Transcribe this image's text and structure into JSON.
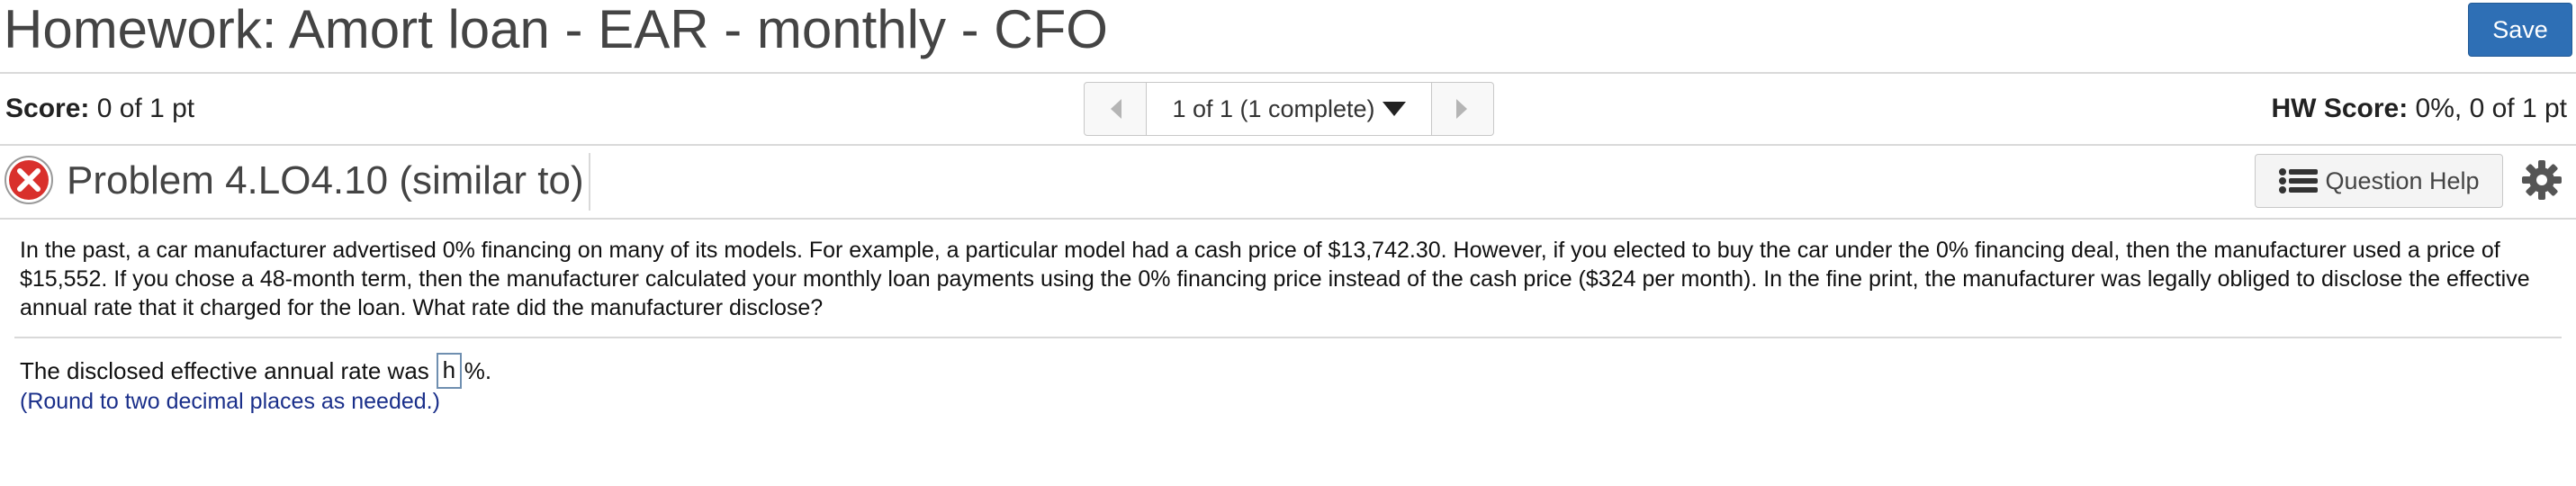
{
  "header": {
    "title": "Homework: Amort loan - EAR - monthly - CFO",
    "save_label": "Save"
  },
  "score": {
    "score_label": "Score:",
    "score_value": "0 of 1 pt",
    "nav_text": "1 of 1 (1 complete)",
    "hw_label": "HW Score:",
    "hw_value": "0%, 0 of 1 pt"
  },
  "problem": {
    "status_icon": "x-circle-icon",
    "title": "Problem 4.LO4.10 (similar to)",
    "help_label": "Question Help"
  },
  "question": {
    "text": "In the past, a car manufacturer advertised 0% financing on many of its models. For example, a particular model had a cash price of $13,742.30. However, if you elected to buy the car under the 0% financing deal, then the manufacturer used a price of $15,552. If you chose a 48-month term, then the manufacturer calculated your monthly loan payments using the 0% financing price instead of the cash price ($324 per month). In the fine print, the manufacturer was legally obliged to disclose the effective annual rate that it charged for the loan. What rate did the manufacturer disclose?",
    "answer_prefix": "The disclosed effective annual rate was",
    "answer_value": "h",
    "answer_suffix": "%.",
    "hint": "(Round to two decimal places as needed.)"
  },
  "colors": {
    "save_button": "#2e6fb5",
    "hint_text": "#1a2f8a",
    "error_icon": "#d9302c"
  }
}
